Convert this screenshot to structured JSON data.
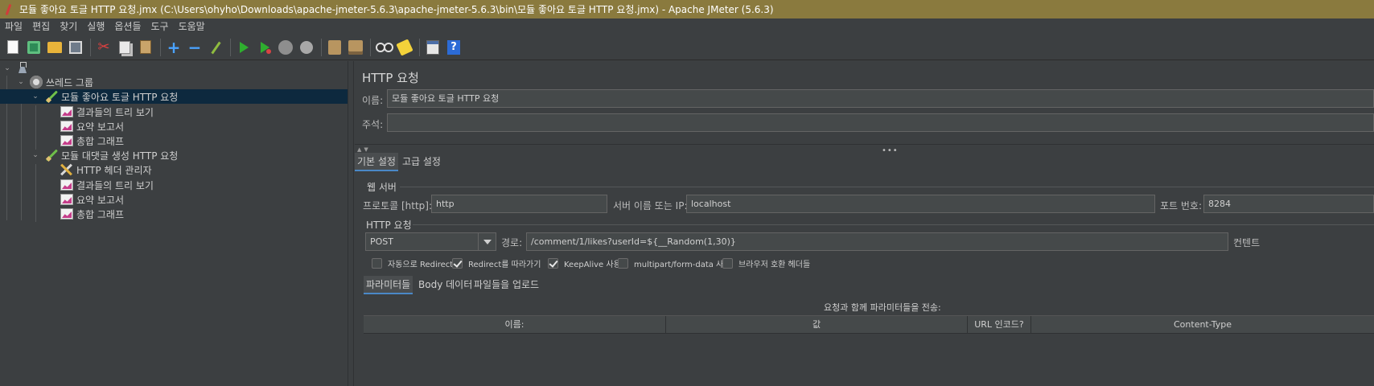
{
  "window": {
    "title": "모듈 좋아요 토글 HTTP 요청.jmx (C:\\Users\\ohyho\\Downloads\\apache-jmeter-5.6.3\\apache-jmeter-5.6.3\\bin\\모듈 좋아요 토글 HTTP 요청.jmx) - Apache JMeter (5.6.3)"
  },
  "menu": [
    "파일",
    "편집",
    "찾기",
    "실행",
    "옵션들",
    "도구",
    "도움말"
  ],
  "toolbar": {
    "icons": [
      "new-icon",
      "templates-icon",
      "open-icon",
      "save-icon",
      "cut-icon",
      "copy-icon",
      "paste-icon",
      "add-icon",
      "remove-icon",
      "toggle-icon",
      "start-icon",
      "start-no-pauses-icon",
      "stop-icon",
      "shutdown-icon",
      "clear-icon",
      "clear-all-icon",
      "search-icon",
      "reset-search-icon",
      "function-helper-icon",
      "help-icon"
    ],
    "cut_glyph": "✂",
    "plus_glyph": "+",
    "minus_glyph": "−",
    "help_glyph": "?"
  },
  "tree": {
    "thread_group": "쓰레드 그룹",
    "sampler1": {
      "label": "모듈 좋아요 토글 HTTP 요청",
      "children": [
        "결과들의 트리 보기",
        "요약 보고서",
        "총합 그래프"
      ]
    },
    "sampler2": {
      "label": "모듈 대댓글 생성 HTTP 요청",
      "children": [
        "HTTP 헤더 관리자",
        "결과들의 트리 보기",
        "요약 보고서",
        "총합 그래프"
      ]
    }
  },
  "panel": {
    "title": "HTTP 요청",
    "name_label": "이름:",
    "name_value": "모듈 좋아요 토글 HTTP 요청",
    "comment_label": "주석:",
    "comment_value": "",
    "tabs": [
      "기본 설정",
      "고급 설정"
    ],
    "web_server": {
      "group_title": "웹 서버",
      "protocol_label": "프로토콜 [http]:",
      "protocol_value": "http",
      "server_label": "서버 이름 또는 IP:",
      "server_value": "localhost",
      "port_label": "포트 번호:",
      "port_value": "8284"
    },
    "http_request": {
      "group_title": "HTTP 요청",
      "method": "POST",
      "path_label": "경로:",
      "path_value": "/comment/1/likes?userId=${__Random(1,30)}",
      "content_label": "컨텐트"
    },
    "checkboxes": [
      {
        "label": "자동으로 Redirect",
        "checked": false
      },
      {
        "label": "Redirect를 따라가기",
        "checked": true
      },
      {
        "label": "KeepAlive 사용",
        "checked": true
      },
      {
        "label": "multipart/form-data 사용",
        "checked": false
      },
      {
        "label": "브라우저 호환 헤더들",
        "checked": false
      }
    ],
    "subtabs": [
      "파라미터들",
      "Body 데이터",
      "파일들을 업로드"
    ],
    "params_caption": "요청과 함께 파라미터들을 전송:",
    "columns": [
      "이름:",
      "값",
      "URL 인코드?",
      "Content-Type"
    ]
  },
  "colors": {
    "titlebar": "#8a7a3e",
    "background": "#3c3f41",
    "selection": "#0d293e",
    "accent": "#4a88c7"
  }
}
